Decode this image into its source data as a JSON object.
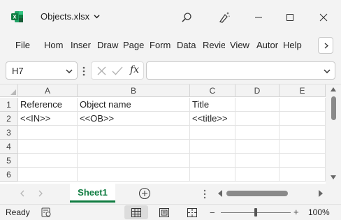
{
  "window": {
    "file_name": "Objects.xlsx",
    "colors": {
      "brand": "#107c41",
      "chrome": "#f3f3f3"
    }
  },
  "ribbon": {
    "tabs": [
      "File",
      "Hom",
      "Inser",
      "Draw",
      "Page",
      "Form",
      "Data",
      "Revie",
      "View",
      "Autor",
      "Help"
    ]
  },
  "formula_bar": {
    "name_box": "H7",
    "fx_label": "fx",
    "formula_value": ""
  },
  "sheet": {
    "columns": [
      "A",
      "B",
      "C",
      "D",
      "E"
    ],
    "rows": [
      "1",
      "2",
      "3",
      "4",
      "5",
      "6"
    ],
    "cells": {
      "A1": "Reference",
      "B1": "Object name",
      "C1": "Title",
      "A2": "<<IN>>",
      "B2": "<<OB>>",
      "C2": "<<title>>"
    }
  },
  "sheet_tabs": {
    "active": "Sheet1"
  },
  "status_bar": {
    "status": "Ready",
    "zoom_minus": "−",
    "zoom_plus": "+",
    "zoom_level": "100%"
  }
}
